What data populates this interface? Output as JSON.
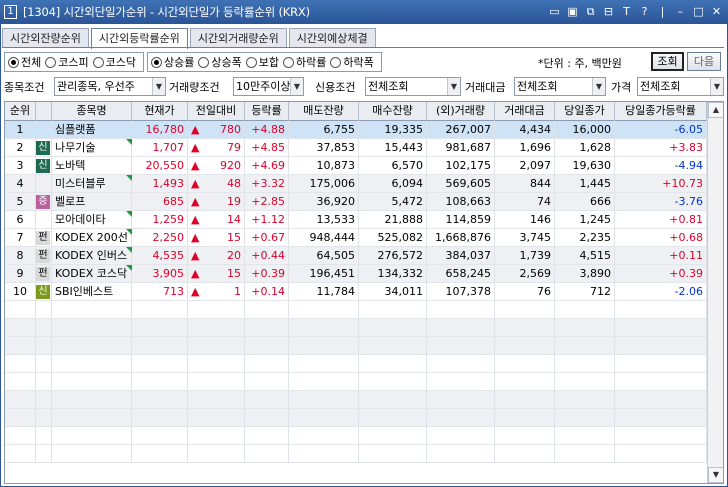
{
  "window": {
    "number": "1",
    "title": "[1304] 시간외단일가순위 - 시간외단일가 등락률순위 (KRX)",
    "tools": [
      "▭",
      "▣",
      "⧉",
      "⊟",
      "T",
      "?",
      "|",
      "–",
      "□",
      "✕"
    ]
  },
  "tabs": [
    {
      "label": "시간외잔량순위",
      "active": false
    },
    {
      "label": "시간외등락률순위",
      "active": true
    },
    {
      "label": "시간외거래량순위",
      "active": false
    },
    {
      "label": "시간외예상체결",
      "active": false
    }
  ],
  "market_radios": [
    {
      "label": "전체",
      "on": true
    },
    {
      "label": "코스피",
      "on": false
    },
    {
      "label": "코스닥",
      "on": false
    }
  ],
  "sort_radios": [
    {
      "label": "상승률",
      "on": true
    },
    {
      "label": "상승폭",
      "on": false
    },
    {
      "label": "보합",
      "on": false
    },
    {
      "label": "하락률",
      "on": false
    },
    {
      "label": "하락폭",
      "on": false
    }
  ],
  "unit_text": "*단위 : 주, 백만원",
  "query_button": "조회",
  "next_button": "다음",
  "filters": {
    "stock_condition_label": "종목조건",
    "stock_condition_value": "관리종목, 우선주",
    "volume_condition_label": "거래량조건",
    "volume_condition_value": "10만주이상",
    "credit_condition_label": "신용조건",
    "credit_condition_value": "전체조회",
    "trade_amount_label": "거래대금",
    "trade_amount_value": "전체조회",
    "price_label": "가격",
    "price_value": "전체조회"
  },
  "columns": [
    "순위",
    "",
    "종목명",
    "현재가",
    "전일대비",
    "등락률",
    "매도잔량",
    "매수잔량",
    "(외)거래량",
    "거래대금",
    "당일종가",
    "당일종가등락률"
  ],
  "rows": [
    {
      "rank": "1",
      "badge": "",
      "name": "심플랫폼",
      "flag": false,
      "price": "16,780",
      "arrow": "▲",
      "change": "780",
      "rate": "+4.88",
      "ask": "6,755",
      "bid": "19,335",
      "volume": "267,007",
      "amount": "4,434",
      "close": "16,000",
      "close_rate": "-6.05"
    },
    {
      "rank": "2",
      "badge": "신",
      "name": "나무기술",
      "flag": true,
      "price": "1,707",
      "arrow": "▲",
      "change": "79",
      "rate": "+4.85",
      "ask": "37,853",
      "bid": "15,443",
      "volume": "981,687",
      "amount": "1,696",
      "close": "1,628",
      "close_rate": "+3.83"
    },
    {
      "rank": "3",
      "badge": "신",
      "name": "노바텍",
      "flag": false,
      "price": "20,550",
      "arrow": "▲",
      "change": "920",
      "rate": "+4.69",
      "ask": "10,873",
      "bid": "6,570",
      "volume": "102,175",
      "amount": "2,097",
      "close": "19,630",
      "close_rate": "-4.94"
    },
    {
      "rank": "4",
      "badge": "",
      "name": "미스터블루",
      "flag": true,
      "price": "1,493",
      "arrow": "▲",
      "change": "48",
      "rate": "+3.32",
      "ask": "175,006",
      "bid": "6,094",
      "volume": "569,605",
      "amount": "844",
      "close": "1,445",
      "close_rate": "+10.73"
    },
    {
      "rank": "5",
      "badge": "증",
      "name": "벨로프",
      "flag": false,
      "price": "685",
      "arrow": "▲",
      "change": "19",
      "rate": "+2.85",
      "ask": "36,920",
      "bid": "5,472",
      "volume": "108,663",
      "amount": "74",
      "close": "666",
      "close_rate": "-3.76"
    },
    {
      "rank": "6",
      "badge": "",
      "name": "모아데이타",
      "flag": true,
      "price": "1,259",
      "arrow": "▲",
      "change": "14",
      "rate": "+1.12",
      "ask": "13,533",
      "bid": "21,888",
      "volume": "114,859",
      "amount": "146",
      "close": "1,245",
      "close_rate": "+0.81"
    },
    {
      "rank": "7",
      "badge": "펀",
      "name": "KODEX 200선",
      "flag": true,
      "price": "2,250",
      "arrow": "▲",
      "change": "15",
      "rate": "+0.67",
      "ask": "948,444",
      "bid": "525,082",
      "volume": "1,668,876",
      "amount": "3,745",
      "close": "2,235",
      "close_rate": "+0.68"
    },
    {
      "rank": "8",
      "badge": "펀",
      "name": "KODEX 인버스",
      "flag": true,
      "price": "4,535",
      "arrow": "▲",
      "change": "20",
      "rate": "+0.44",
      "ask": "64,505",
      "bid": "276,572",
      "volume": "384,037",
      "amount": "1,739",
      "close": "4,515",
      "close_rate": "+0.11"
    },
    {
      "rank": "9",
      "badge": "펀",
      "name": "KODEX 코스닥",
      "flag": true,
      "price": "3,905",
      "arrow": "▲",
      "change": "15",
      "rate": "+0.39",
      "ask": "196,451",
      "bid": "134,332",
      "volume": "658,245",
      "amount": "2,569",
      "close": "3,890",
      "close_rate": "+0.39"
    },
    {
      "rank": "10",
      "badge": "신",
      "name": "SBI인베스트",
      "flag": false,
      "price": "713",
      "arrow": "▲",
      "change": "1",
      "rate": "+0.14",
      "ask": "11,784",
      "bid": "34,011",
      "volume": "107,378",
      "amount": "76",
      "close": "712",
      "close_rate": "-2.06"
    }
  ],
  "colors": {
    "up": "#e0002a",
    "down": "#0033cc",
    "selected_row": "#cfe3f7",
    "titlebar": "#2a5597"
  }
}
